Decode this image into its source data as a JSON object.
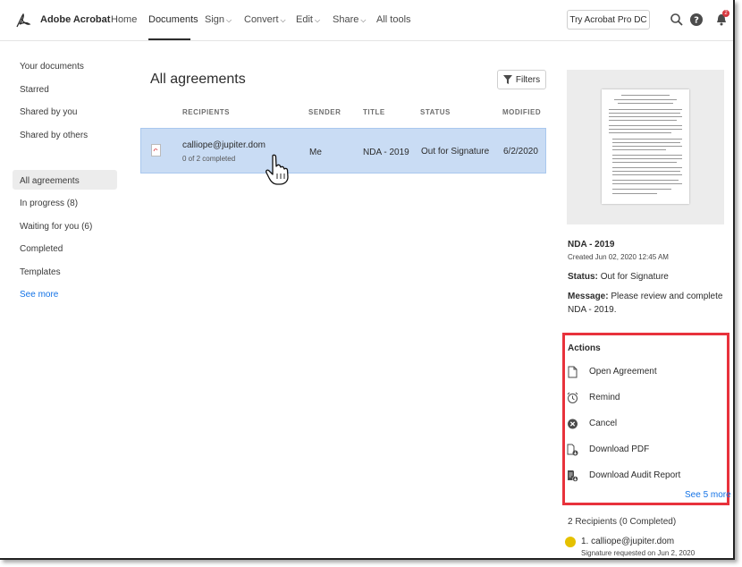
{
  "app": {
    "brand": "Adobe Acrobat"
  },
  "nav": {
    "home": "Home",
    "documents": "Documents",
    "sign": "Sign",
    "convert": "Convert",
    "edit": "Edit",
    "share": "Share",
    "all_tools": "All tools",
    "try_button": "Try Acrobat Pro DC",
    "notification_count": "2"
  },
  "sidebar": {
    "top": [
      "Your documents",
      "Starred",
      "Shared by you",
      "Shared by others"
    ],
    "agreements": [
      "All agreements",
      "In progress (8)",
      "Waiting for you (6)",
      "Completed",
      "Templates"
    ],
    "see_more": "See more"
  },
  "main": {
    "title": "All agreements",
    "filters": "Filters",
    "columns": [
      "RECIPIENTS",
      "SENDER",
      "TITLE",
      "STATUS",
      "MODIFIED"
    ],
    "rows": [
      {
        "recipient": "calliope@jupiter.dom",
        "progress": "0 of 2 completed",
        "sender": "Me",
        "title": "NDA - 2019",
        "status": "Out for Signature",
        "modified": "6/2/2020"
      }
    ]
  },
  "details": {
    "title": "NDA - 2019",
    "created": "Created Jun 02, 2020 12:45 AM",
    "status_label": "Status:",
    "status_value": "Out for Signature",
    "message_label": "Message:",
    "message_value": "Please review and complete",
    "message_value_2": "NDA - 2019.",
    "actions_heading": "Actions",
    "actions": [
      "Open Agreement",
      "Remind",
      "Cancel",
      "Download PDF",
      "Download Audit Report"
    ],
    "see_more_actions": "See 5 more",
    "recipients_heading": "2 Recipients (0 Completed)",
    "recipient_1": "1. calliope@jupiter.dom",
    "recipient_1_note": "Signature requested on Jun 2, 2020"
  },
  "colors": {
    "accent": "#1473e6",
    "selected_row": "#c9dcf4",
    "highlight_box": "#e8323c"
  }
}
